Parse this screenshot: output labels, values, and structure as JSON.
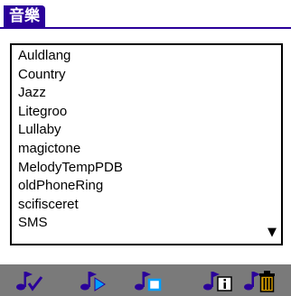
{
  "title": "音樂",
  "songs": [
    "Auldlang",
    "Country",
    "Jazz",
    "Litegroo",
    "Lullaby",
    "magictone",
    "MelodyTempPDB",
    "oldPhoneRing",
    "scifisceret",
    "SMS"
  ],
  "scroll_indicator": "▼",
  "toolbar": {
    "icons": [
      "note-check-icon",
      "note-play-icon",
      "note-new-icon",
      "note-info-icon",
      "note-delete-icon"
    ],
    "accent_color": "#2a009a",
    "bar_color": "#7a7a7a"
  }
}
